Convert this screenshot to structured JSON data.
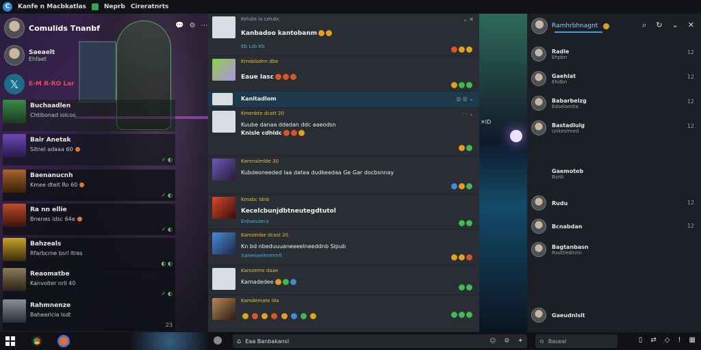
{
  "topbar": {
    "app_name": "Kanfe n Macbkatlas",
    "tab_1": "Neprb",
    "tab_2": "Cireratnrts"
  },
  "left": {
    "header_title": "Comulids Tnanbf",
    "header_icons": [
      "💬",
      "⚙",
      "⋯"
    ],
    "profile_name": "Saeaelt",
    "profile_sub": "Ehfaet",
    "x_label": "E-M R-RO Lar",
    "chats": [
      {
        "name": "Buchaadlen",
        "preview": "Chtibonad iolcos",
        "meta": "✓✓"
      },
      {
        "name": "Bair Anetak",
        "preview": "Sitnel adaaa 60",
        "meta": "✓ ◐"
      },
      {
        "name": "Baenanucnh",
        "preview": "Kmee dtelt Ro 60",
        "meta": "✓ ◐"
      },
      {
        "name": "Ra nn ellie",
        "preview": "Bnenes idsc 64e",
        "meta": "✓ ◐"
      },
      {
        "name": "Bahzeals",
        "preview": "Rfarbcrne bsrl ltres",
        "meta": "◐ ◐"
      },
      {
        "name": "Reaomatbe",
        "preview": "Kanvolter nrll 40",
        "meta": "✓ ◐"
      },
      {
        "name": "Rahmnenze",
        "preview": "Baheerlcia Isdt",
        "meta": "23"
      }
    ]
  },
  "feed": {
    "messages": [
      {
        "author": "Kelubs lu Lelubc",
        "body": "Kanbadoo kantobanm",
        "link": "Kb Lsb Kb",
        "time": "⌄ ✕"
      },
      {
        "author": "Kmsblodnn dbe",
        "body": "Eaue Iasc",
        "link": "",
        "time": ""
      },
      {
        "author": "",
        "body": "Kanltadlom",
        "link": "",
        "time": "◎ ◎ ⌄"
      },
      {
        "author": "Kmenbte dcatt 20",
        "body": "Kuube danaa ddedan ddc aaeodsn",
        "link": "Knisle cdhldc",
        "time": "· · ⌄"
      },
      {
        "author": "Kamnalmlde 30",
        "body": "Kubdeoneeded laa datea dudkeedaa Ge Gar docbsnnay",
        "link": "",
        "time": ""
      },
      {
        "author": "Kmabc ldnb",
        "body": "Kecelcbunjdbtneutegdtutol",
        "link": "Enbaeuleca",
        "time": ""
      },
      {
        "author": "Kamzenbe dcast 20",
        "body": "Kn bd nbeduuuaneeeelneeddnb Sipub",
        "link": "Xaneeaelenmnrll",
        "time": ""
      },
      {
        "author": "Kamzeme daae",
        "body": "Kamadedee",
        "link": "",
        "time": ""
      },
      {
        "author": "Kamdemate lda",
        "body": "",
        "link": "",
        "time": ""
      }
    ]
  },
  "strip": {
    "time": "✕ID"
  },
  "right": {
    "header": "Ramhrbhnagnt",
    "members": [
      {
        "name": "Radle",
        "sub": "Ehpbn",
        "time": "12"
      },
      {
        "name": "Gaehlat",
        "sub": "Ehdbn",
        "time": "12"
      },
      {
        "name": "Babarbelzg",
        "sub": "Edselaenta",
        "time": "12"
      },
      {
        "name": "Bastadlulg",
        "sub": "Unkevlmed",
        "time": "12"
      },
      {
        "name": "Gaemoteb",
        "sub": "Bsnb",
        "time": ""
      },
      {
        "name": "Rudu",
        "sub": "",
        "time": "12"
      },
      {
        "name": "Bcnabdan",
        "sub": "",
        "time": "12"
      },
      {
        "name": "Bagtanbasn",
        "sub": "Rasttledlnnn",
        "time": ""
      },
      {
        "name": "Gaeudnlslt",
        "sub": "",
        "time": ""
      }
    ]
  },
  "taskbar": {
    "compose_placeholder": "Eaa Banbakansl",
    "search_label": "Baseal"
  }
}
